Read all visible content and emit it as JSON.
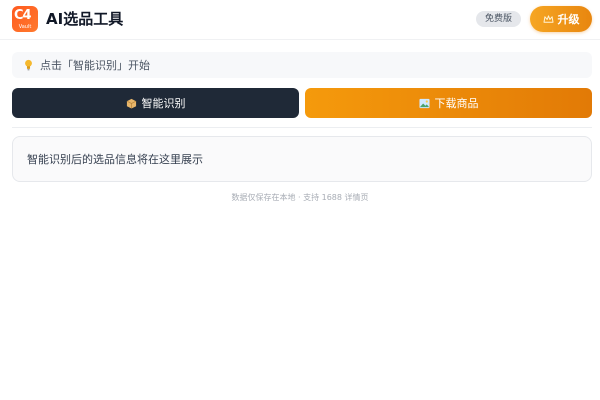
{
  "header": {
    "logo_label": "Vault",
    "title": "AI选品工具",
    "plan_badge": "免费版",
    "upgrade_label": "升级"
  },
  "hint": {
    "icon": "lightbulb-icon",
    "text": "点击「智能识别」开始"
  },
  "actions": {
    "identify_label": "智能识别",
    "identify_icon": "package-icon",
    "download_label": "下载商品",
    "download_icon": "image-icon"
  },
  "result": {
    "placeholder": "智能识别后的选品信息将在这里展示"
  },
  "footer": {
    "text": "数据仅保存在本地 · 支持 1688 详情页"
  },
  "colors": {
    "brand": "#ff5a1f",
    "upgrade": "#f6a623",
    "dark_button": "#1f2937",
    "download_button": "#f59a0c"
  }
}
